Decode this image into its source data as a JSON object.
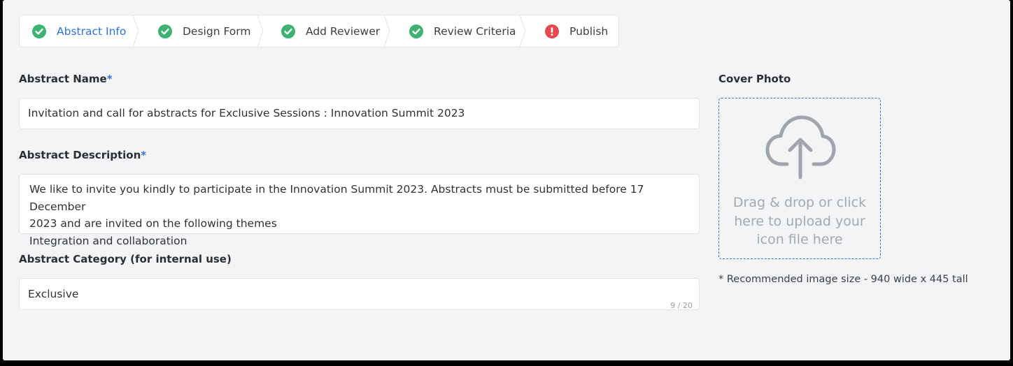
{
  "steps": [
    {
      "label": "Abstract Info",
      "status": "complete",
      "active": true
    },
    {
      "label": "Design Form",
      "status": "complete",
      "active": false
    },
    {
      "label": "Add Reviewer",
      "status": "complete",
      "active": false
    },
    {
      "label": "Review Criteria",
      "status": "complete",
      "active": false
    },
    {
      "label": "Publish",
      "status": "error",
      "active": false
    }
  ],
  "form": {
    "name": {
      "label": "Abstract Name",
      "required_mark": "*",
      "value": "Invitation and call for abstracts for Exclusive Sessions : Innovation Summit 2023"
    },
    "description": {
      "label": "Abstract Description",
      "required_mark": "*",
      "value": "We like to invite you kindly to participate in the Innovation Summit 2023. Abstracts must be submitted before 17 December\n2023 and are invited on the following themes\nIntegration and collaboration"
    },
    "category": {
      "label": "Abstract Category (for internal use)",
      "value": "Exclusive",
      "counter": "9 / 20"
    }
  },
  "cover": {
    "label": "Cover Photo",
    "upload_text": "Drag & drop or click\nhere to upload your\nicon file here",
    "hint": "* Recommended image size - 940 wide x 445 tall",
    "icon": "cloud-upload-icon"
  },
  "colors": {
    "accent": "#2f73d9",
    "success": "#3cb371",
    "error": "#e5484d",
    "background": "#f3f4f6"
  }
}
